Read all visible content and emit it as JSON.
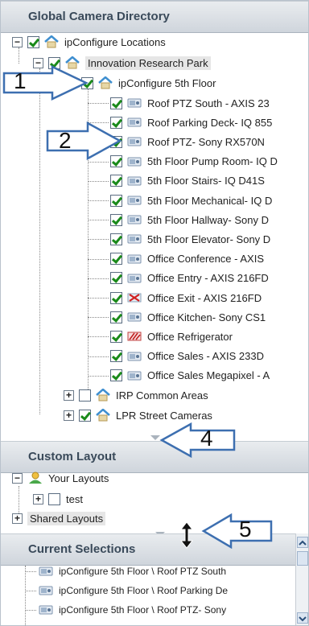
{
  "directory": {
    "title": "Global Camera Directory",
    "root": "ipConfigure Locations",
    "site": "Innovation Research Park",
    "floor": "ipConfigure 5th Floor",
    "cameras": [
      {
        "label": "Roof PTZ South - AXIS 23",
        "status": "ok"
      },
      {
        "label": "Roof Parking Deck- IQ 855",
        "status": "ok"
      },
      {
        "label": "Roof PTZ- Sony RX570N",
        "status": "ok"
      },
      {
        "label": "5th Floor Pump Room- IQ D",
        "status": "ok"
      },
      {
        "label": "5th Floor Stairs- IQ D41S",
        "status": "ok"
      },
      {
        "label": "5th Floor Mechanical- IQ D",
        "status": "ok"
      },
      {
        "label": "5th Floor Hallway- Sony D",
        "status": "ok"
      },
      {
        "label": "5th Floor Elevator- Sony D",
        "status": "ok"
      },
      {
        "label": "Office Conference - AXIS",
        "status": "ok"
      },
      {
        "label": "Office Entry - AXIS 216FD",
        "status": "ok"
      },
      {
        "label": "Office Exit - AXIS 216FD",
        "status": "error"
      },
      {
        "label": "Office Kitchen- Sony CS1",
        "status": "ok"
      },
      {
        "label": "Office Refrigerator",
        "status": "warning"
      },
      {
        "label": "Office Sales - AXIS 233D",
        "status": "ok"
      },
      {
        "label": "Office Sales Megapixel - A",
        "status": "ok"
      }
    ],
    "groups": [
      {
        "label": "IRP Common Areas",
        "checked": false
      },
      {
        "label": "LPR Street Cameras",
        "checked": true
      }
    ]
  },
  "custom_layout": {
    "title": "Custom Layout",
    "your_layouts": "Your Layouts",
    "test": "test",
    "shared": "Shared Layouts"
  },
  "current_selections": {
    "title": "Current Selections",
    "items": [
      "ipConfigure 5th Floor \\ Roof PTZ South",
      "ipConfigure 5th Floor \\ Roof Parking De",
      "ipConfigure 5th Floor \\ Roof PTZ- Sony"
    ]
  },
  "callouts": {
    "c1": "1",
    "c2": "2",
    "c4": "4",
    "c5": "5"
  },
  "colors": {
    "check": "#1a8a1a",
    "header_text": "#3a4a5a",
    "folder": "#3f8fd0"
  }
}
